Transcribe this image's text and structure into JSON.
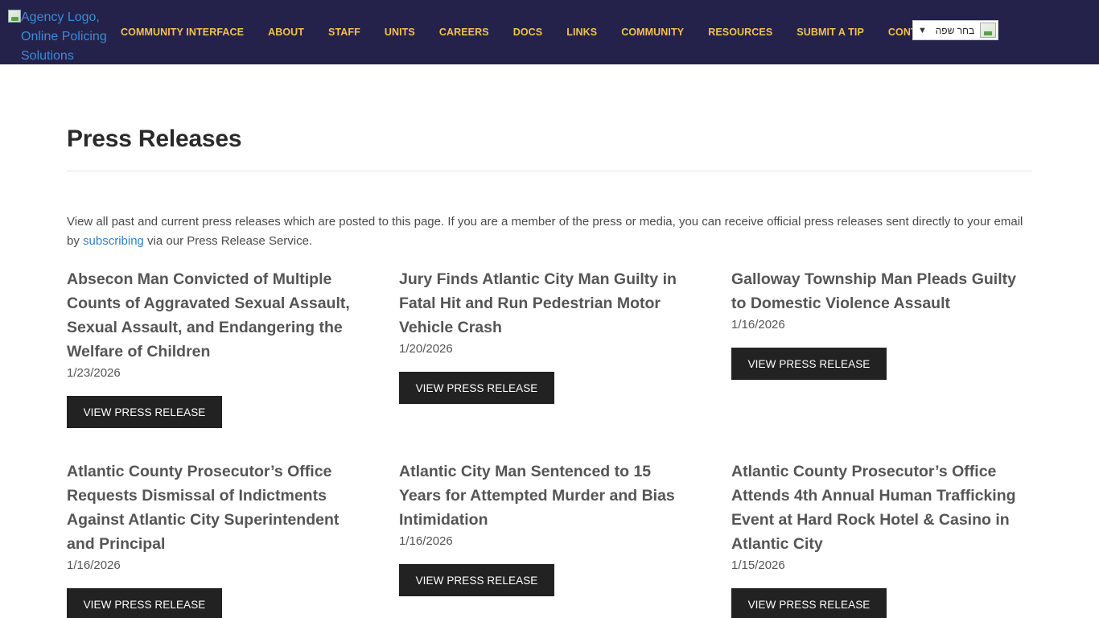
{
  "header": {
    "logo_alt": "Agency Logo, Online Policing Solutions",
    "nav": [
      "COMMUNITY INTERFACE",
      "ABOUT",
      "STAFF",
      "UNITS",
      "CAREERS",
      "DOCS",
      "LINKS",
      "COMMUNITY",
      "RESOURCES",
      "SUBMIT A TIP",
      "CONTACT"
    ],
    "language_select": {
      "label": "בחר שפה",
      "arrow": "▼"
    }
  },
  "colors": {
    "header_bg": "#24224a",
    "nav_text": "#f2c14e",
    "button_bg": "#222222",
    "link": "#2f7fc7"
  },
  "page": {
    "title": "Press Releases",
    "intro_before": "View all past and current press releases which are posted to this page. If you are a member of the press or media, you can receive official press releases sent directly to your email by ",
    "intro_link": "subscribing",
    "intro_after": " via our Press Release Service."
  },
  "releases": [
    {
      "title": "Absecon Man Convicted of Multiple Counts of Aggravated Sexual Assault, Sexual Assault, and Endangering the Welfare of Children",
      "date": "1/23/2026",
      "button": "VIEW PRESS RELEASE"
    },
    {
      "title": "Jury Finds Atlantic City Man Guilty in Fatal Hit and Run Pedestrian Motor Vehicle Crash",
      "date": "1/20/2026",
      "button": "VIEW PRESS RELEASE"
    },
    {
      "title": "Galloway Township Man Pleads Guilty to Domestic Violence Assault",
      "date": "1/16/2026",
      "button": "VIEW PRESS RELEASE"
    },
    {
      "title": "Atlantic County Prosecutor’s Office Requests Dismissal of Indictments Against Atlantic City Superintendent and Principal",
      "date": "1/16/2026",
      "button": "VIEW PRESS RELEASE"
    },
    {
      "title": "Atlantic City Man Sentenced to 15 Years for Attempted Murder and Bias Intimidation",
      "date": "1/16/2026",
      "button": "VIEW PRESS RELEASE"
    },
    {
      "title": "Atlantic County Prosecutor’s Office Attends 4th Annual Human Trafficking Event at Hard Rock Hotel & Casino in Atlantic City",
      "date": "1/15/2026",
      "button": "VIEW PRESS RELEASE"
    }
  ]
}
